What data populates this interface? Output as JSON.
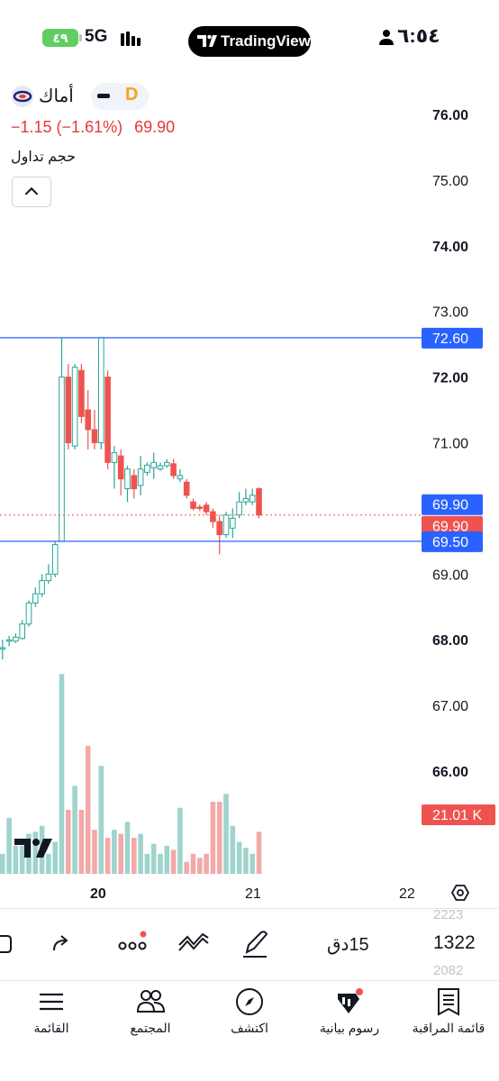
{
  "status_bar": {
    "battery": "٤٩",
    "network": "5G",
    "badge": "TradingView",
    "time": "٦:٥٤"
  },
  "symbol": {
    "name": "أماك",
    "interval_letter": "D",
    "price_change": "−1.15 (−1.61%)",
    "last_price": "69.90",
    "volume_label": "حجم تداول"
  },
  "colors": {
    "up": "#26a69a",
    "up_volume": "#9fd4cd",
    "down": "#ef5350",
    "down_volume": "#f2a9a8",
    "line": "#2962ff",
    "accent": "#f7a31c"
  },
  "chart_data": {
    "type": "candlestick",
    "y_axis": {
      "min": 65.4,
      "max": 76.3,
      "ticks": [
        "76.00",
        "75.00",
        "74.00",
        "73.00",
        "72.00",
        "71.00",
        "69.00",
        "68.00",
        "67.00",
        "66.00"
      ],
      "bold_ticks": [
        "76.00",
        "74.00",
        "72.00",
        "68.00",
        "66.00"
      ]
    },
    "x_axis": {
      "labels": [
        "20",
        "21",
        "22"
      ],
      "bold": [
        "20"
      ]
    },
    "horizontal_lines": [
      {
        "label": "72.60",
        "value": 72.6,
        "kind": "solid"
      },
      {
        "label": "69.50",
        "value": 69.5,
        "kind": "solid"
      },
      {
        "label": "69.90",
        "value": 69.9,
        "kind": "dotted"
      }
    ],
    "price_tags": [
      {
        "label": "69.90",
        "kind": "line"
      },
      {
        "label": "69.90",
        "kind": "last"
      },
      {
        "label": "21.01 K",
        "kind": "volume"
      }
    ],
    "candles": [
      [
        67.86,
        68.0,
        67.7,
        67.88
      ],
      [
        68.0,
        68.06,
        67.9,
        68.0
      ],
      [
        67.98,
        68.1,
        67.95,
        68.04
      ],
      [
        68.02,
        68.3,
        68.0,
        68.24
      ],
      [
        68.24,
        68.6,
        68.2,
        68.56
      ],
      [
        68.56,
        68.8,
        68.5,
        68.7
      ],
      [
        68.7,
        69.0,
        68.65,
        68.9
      ],
      [
        68.9,
        69.15,
        68.85,
        69.0
      ],
      [
        69.0,
        69.5,
        68.95,
        69.45
      ],
      [
        69.5,
        72.6,
        69.5,
        72.0
      ],
      [
        72.0,
        72.2,
        70.9,
        71.0
      ],
      [
        70.95,
        72.2,
        70.9,
        72.15
      ],
      [
        72.1,
        72.2,
        71.3,
        71.4
      ],
      [
        71.5,
        71.8,
        70.9,
        71.2
      ],
      [
        71.2,
        71.5,
        70.9,
        71.0
      ],
      [
        71.0,
        72.6,
        70.9,
        72.6
      ],
      [
        72.0,
        72.1,
        70.6,
        70.7
      ],
      [
        70.7,
        70.95,
        70.3,
        70.85
      ],
      [
        70.8,
        70.9,
        70.2,
        70.45
      ],
      [
        70.3,
        70.65,
        70.1,
        70.6
      ],
      [
        70.5,
        70.6,
        70.15,
        70.3
      ],
      [
        70.35,
        70.8,
        70.2,
        70.6
      ],
      [
        70.55,
        70.7,
        70.5,
        70.66
      ],
      [
        70.62,
        70.85,
        70.45,
        70.7
      ],
      [
        70.6,
        70.7,
        70.57,
        70.65
      ],
      [
        70.65,
        70.75,
        70.62,
        70.7
      ],
      [
        70.68,
        70.75,
        70.45,
        70.5
      ],
      [
        70.45,
        70.6,
        70.4,
        70.5
      ],
      [
        70.4,
        70.45,
        70.15,
        70.2
      ],
      [
        70.1,
        70.15,
        69.97,
        70.0
      ],
      [
        70.02,
        70.06,
        69.96,
        70.0
      ],
      [
        70.05,
        70.1,
        69.9,
        69.95
      ],
      [
        69.95,
        70.0,
        69.7,
        69.8
      ],
      [
        69.8,
        69.9,
        69.3,
        69.6
      ],
      [
        69.6,
        69.95,
        69.55,
        69.9
      ],
      [
        69.7,
        70.0,
        69.55,
        69.85
      ],
      [
        69.9,
        70.25,
        69.85,
        70.1
      ],
      [
        70.1,
        70.3,
        70.05,
        70.15
      ],
      [
        70.1,
        70.3,
        70.05,
        70.2
      ],
      [
        70.3,
        70.32,
        69.85,
        69.9
      ]
    ],
    "volumes": [
      10,
      28,
      14,
      14,
      20,
      21,
      24,
      10,
      16,
      100,
      32,
      44,
      32,
      64,
      22,
      54,
      18,
      22,
      20,
      26,
      18,
      20,
      10,
      15,
      10,
      14,
      12,
      33,
      6,
      10,
      8,
      10,
      36,
      36,
      40,
      24,
      16,
      13,
      10,
      21
    ],
    "volume_max": 100
  },
  "toolbar": {
    "interval": "15دق",
    "symbol_prev": "2223",
    "symbol_current": "1322",
    "symbol_next": "2082"
  },
  "bottom_nav": {
    "items": [
      {
        "label": "القائمة",
        "icon": "menu-icon"
      },
      {
        "label": "المجتمع",
        "icon": "community-icon"
      },
      {
        "label": "اكتشف",
        "icon": "compass-icon"
      },
      {
        "label": "رسوم بيانية",
        "icon": "chart-icon"
      },
      {
        "label": "قائمة المراقبة",
        "icon": "watchlist-icon"
      }
    ]
  }
}
